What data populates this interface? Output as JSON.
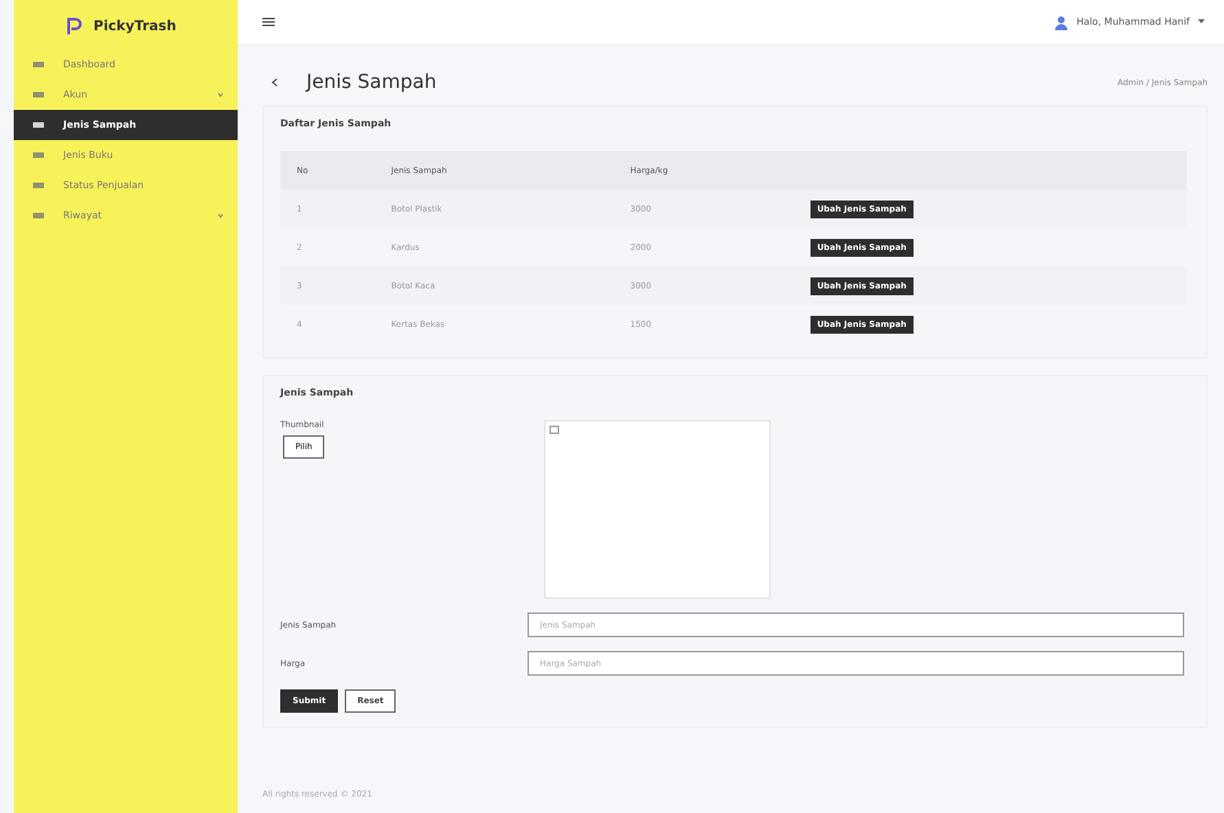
{
  "sidebar": {
    "brand": "PickyTrash",
    "items": [
      {
        "label": "Dashboard",
        "selected": false,
        "expandable": false
      },
      {
        "label": "Akun",
        "selected": false,
        "expandable": true
      },
      {
        "label": "Jenis Sampah",
        "selected": true,
        "expandable": false
      },
      {
        "label": "Jenis Buku",
        "selected": false,
        "expandable": false
      },
      {
        "label": "Status Penjualan",
        "selected": false,
        "expandable": false
      },
      {
        "label": "Riwayat",
        "selected": false,
        "expandable": true
      }
    ]
  },
  "topbar": {
    "user": "Halo, Muhammad Hanif"
  },
  "page": {
    "title": "Jenis Sampah",
    "breadcrumb": "Admin / Jenis Sampah"
  },
  "table": {
    "title": "Daftar Jenis Sampah",
    "columns": [
      "No",
      "Jenis Sampah",
      "Harga/kg"
    ],
    "rows": [
      {
        "cells": [
          "1",
          "Botol Plastik",
          "3000"
        ],
        "action": "Ubah Jenis Sampah"
      },
      {
        "cells": [
          "2",
          "Kardus",
          "2000"
        ],
        "action": "Ubah Jenis Sampah"
      },
      {
        "cells": [
          "3",
          "Botol Kaca",
          "3000"
        ],
        "action": "Ubah Jenis Sampah"
      },
      {
        "cells": [
          "4",
          "Kertas Bekas",
          "1500"
        ],
        "action": "Ubah Jenis Sampah"
      }
    ]
  },
  "form": {
    "title": "Jenis Sampah",
    "thumbnail_label": "Thumbnail",
    "choose_button": "Pilih",
    "fields": [
      {
        "label": "Jenis Sampah",
        "placeholder": "Jenis Sampah"
      },
      {
        "label": "Harga",
        "placeholder": "Harga Sampah"
      }
    ],
    "buttons": [
      {
        "label": "Submit",
        "kind": "primary"
      },
      {
        "label": "Reset",
        "kind": "outline"
      }
    ]
  },
  "footer": "All rights reserved © 2021"
}
